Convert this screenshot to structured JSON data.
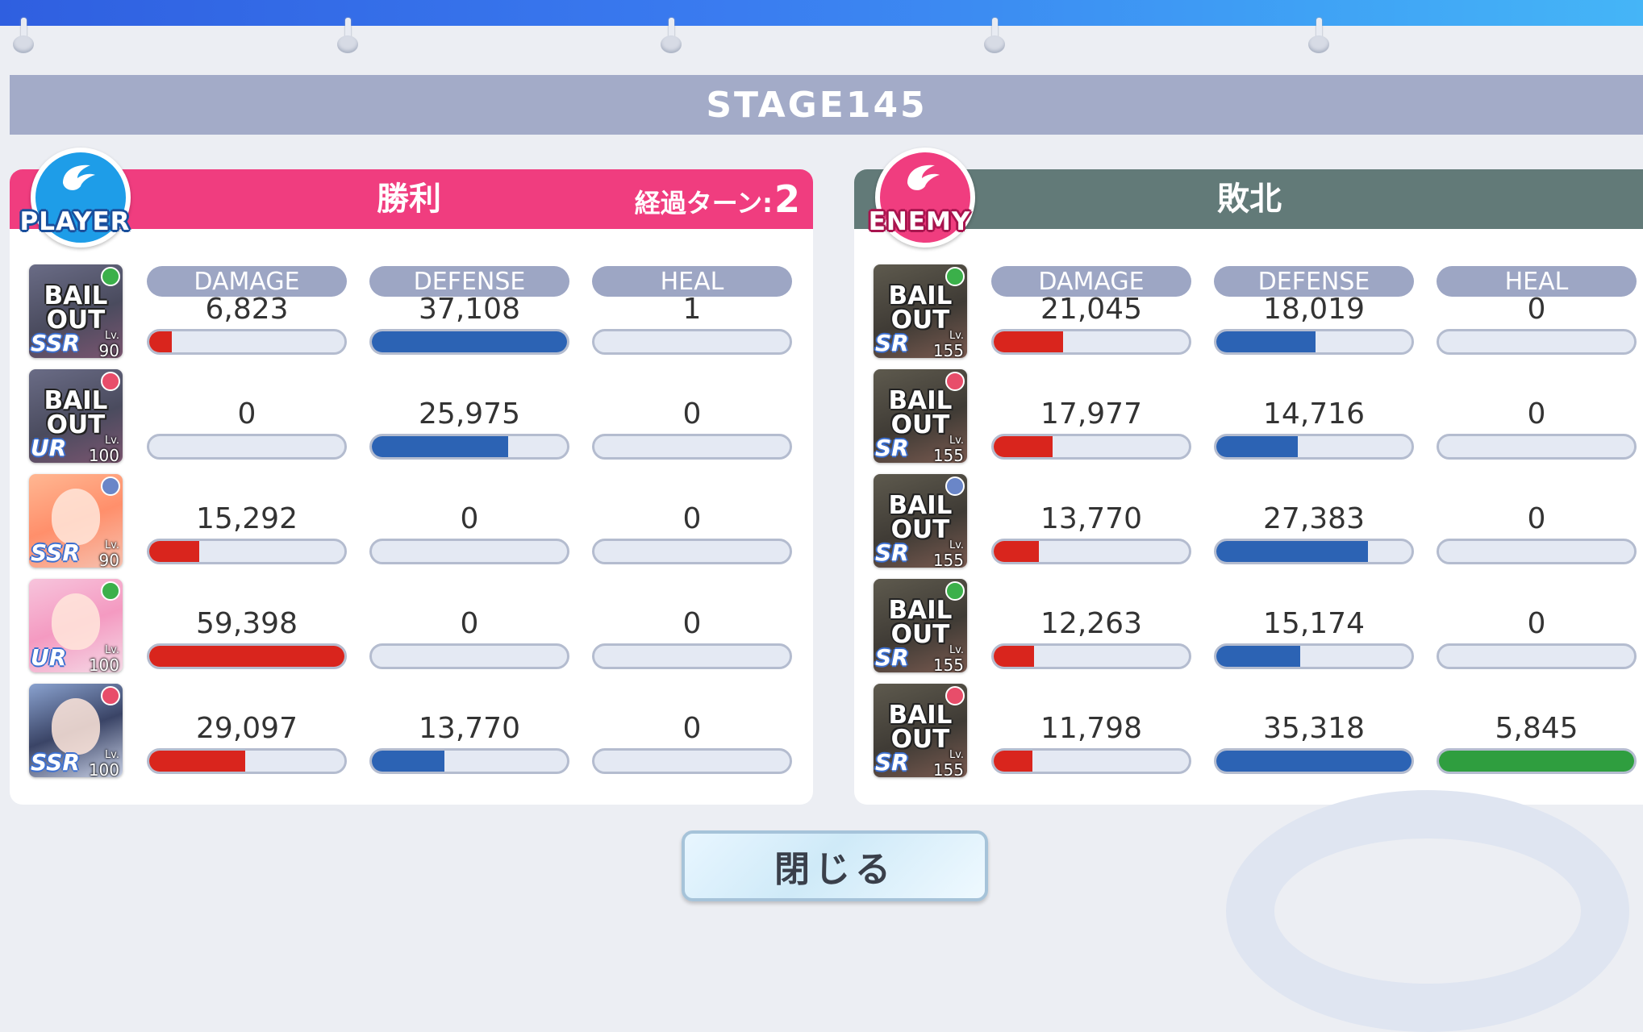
{
  "stage": "STAGE145",
  "player": {
    "badge": "PLAYER",
    "result": "勝利",
    "turns_label": "経過ターン:",
    "turns_value": "2",
    "column_headers": [
      "DAMAGE",
      "DEFENSE",
      "HEAL"
    ],
    "units": [
      {
        "card": "BAIL OUT",
        "rarity": "SSR",
        "level": "90",
        "damage": "6,823",
        "defense": "37,108",
        "heal": "1",
        "damage_frac": 0.115,
        "defense_frac": 1.0,
        "heal_frac": 0.0
      },
      {
        "card": "BAIL OUT",
        "rarity": "UR",
        "level": "100",
        "damage": "0",
        "defense": "25,975",
        "heal": "0",
        "damage_frac": 0.0,
        "defense_frac": 0.7,
        "heal_frac": 0.0
      },
      {
        "card": "",
        "rarity": "SSR",
        "level": "90",
        "damage": "15,292",
        "defense": "0",
        "heal": "0",
        "damage_frac": 0.257,
        "defense_frac": 0.0,
        "heal_frac": 0.0
      },
      {
        "card": "",
        "rarity": "UR",
        "level": "100",
        "damage": "59,398",
        "defense": "0",
        "heal": "0",
        "damage_frac": 1.0,
        "defense_frac": 0.0,
        "heal_frac": 0.0
      },
      {
        "card": "",
        "rarity": "SSR",
        "level": "100",
        "damage": "29,097",
        "defense": "13,770",
        "heal": "0",
        "damage_frac": 0.49,
        "defense_frac": 0.371,
        "heal_frac": 0.0
      }
    ]
  },
  "enemy": {
    "badge": "ENEMY",
    "result": "敗北",
    "column_headers": [
      "DAMAGE",
      "DEFENSE",
      "HEAL"
    ],
    "units": [
      {
        "card": "BAIL OUT",
        "rarity": "SR",
        "level": "155",
        "damage": "21,045",
        "defense": "18,019",
        "heal": "0",
        "damage_frac": 0.354,
        "defense_frac": 0.51,
        "heal_frac": 0.0
      },
      {
        "card": "BAIL OUT",
        "rarity": "SR",
        "level": "155",
        "damage": "17,977",
        "defense": "14,716",
        "heal": "0",
        "damage_frac": 0.303,
        "defense_frac": 0.417,
        "heal_frac": 0.0
      },
      {
        "card": "BAIL OUT",
        "rarity": "SR",
        "level": "155",
        "damage": "13,770",
        "defense": "27,383",
        "heal": "0",
        "damage_frac": 0.232,
        "defense_frac": 0.775,
        "heal_frac": 0.0
      },
      {
        "card": "BAIL OUT",
        "rarity": "SR",
        "level": "155",
        "damage": "12,263",
        "defense": "15,174",
        "heal": "0",
        "damage_frac": 0.206,
        "defense_frac": 0.43,
        "heal_frac": 0.0
      },
      {
        "card": "BAIL OUT",
        "rarity": "SR",
        "level": "155",
        "damage": "11,798",
        "defense": "35,318",
        "heal": "5,845",
        "damage_frac": 0.199,
        "defense_frac": 1.0,
        "heal_frac": 1.0
      }
    ]
  },
  "close_button": "閉じる",
  "colors": {
    "player_header": "#f03d7f",
    "enemy_header": "#627a78",
    "damage": "#d9251d",
    "defense": "#2c63b4",
    "heal": "#2f9e3f"
  }
}
